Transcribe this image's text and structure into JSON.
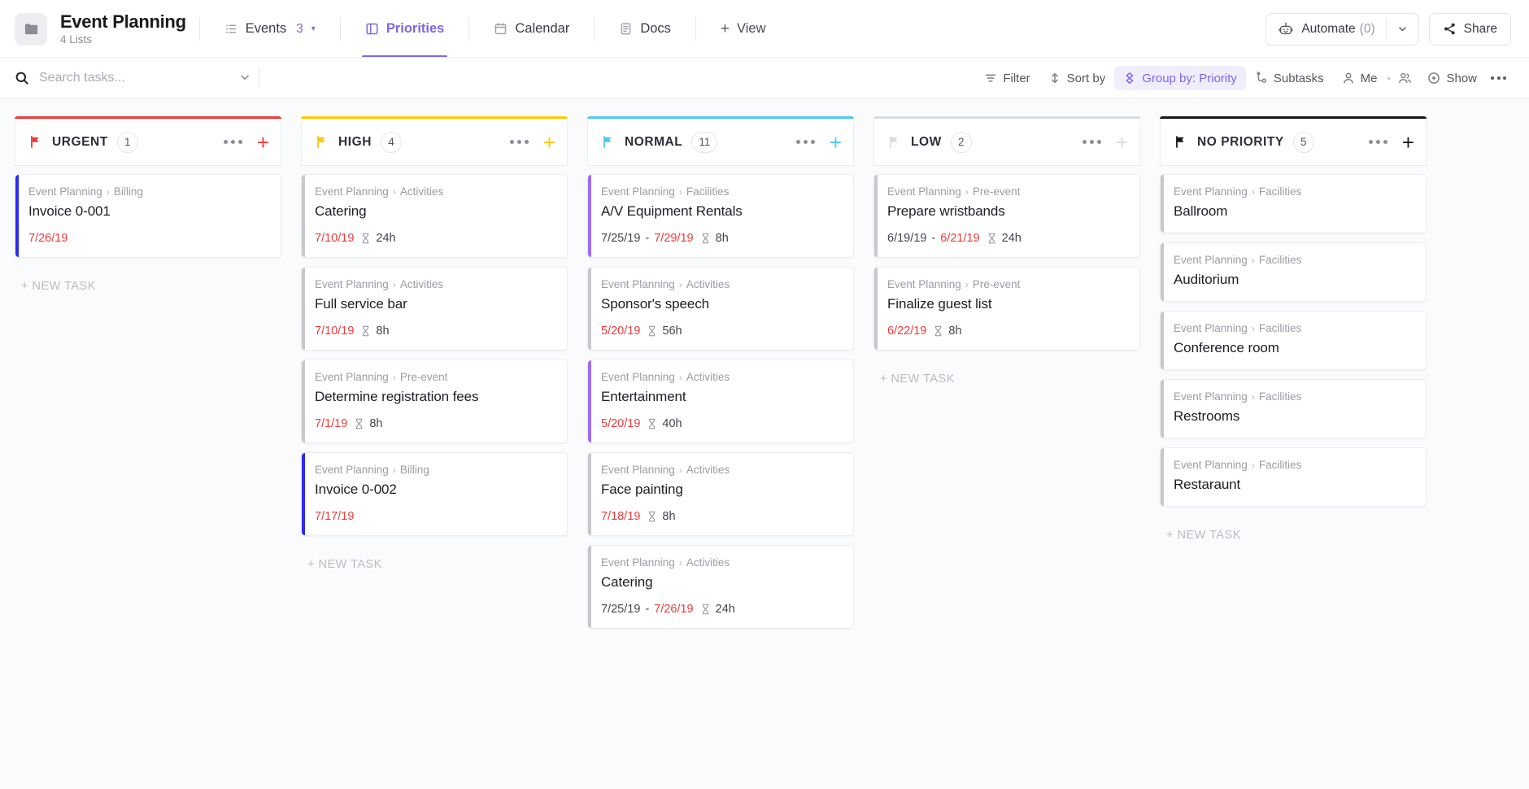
{
  "header": {
    "space_icon": "folder-icon",
    "title": "Event Planning",
    "subtitle": "4 Lists",
    "tabs": [
      {
        "label": "Events",
        "icon": "list-icon",
        "count": "3",
        "caret": "▾",
        "active": false
      },
      {
        "label": "Priorities",
        "icon": "board-icon",
        "active": true
      },
      {
        "label": "Calendar",
        "icon": "calendar-icon",
        "active": false
      },
      {
        "label": "Docs",
        "icon": "doc-icon",
        "active": false
      }
    ],
    "add_view_label": "View",
    "add_view_plus": "+",
    "automate_label": "Automate",
    "automate_count": "(0)",
    "share_label": "Share"
  },
  "toolbar": {
    "search_placeholder": "Search tasks...",
    "search_value": "",
    "items": [
      {
        "label": "Filter",
        "icon": "filter-icon",
        "highlight": false
      },
      {
        "label": "Sort by",
        "icon": "sort-icon",
        "highlight": false
      },
      {
        "label": "Group by: Priority",
        "icon": "group-icon",
        "highlight": true
      },
      {
        "label": "Subtasks",
        "icon": "subtask-icon",
        "highlight": false
      },
      {
        "label": "Me",
        "icon": "person-icon",
        "highlight": false
      },
      {
        "label": "",
        "icon": "people-icon",
        "highlight": false
      },
      {
        "label": "Show",
        "icon": "eye-icon",
        "highlight": false
      }
    ]
  },
  "board": {
    "new_task_label": "+ NEW TASK",
    "columns": [
      {
        "name": "URGENT",
        "count": "1",
        "color": "#f03a3a",
        "flag": "flag-filled-icon",
        "plus_enabled": true,
        "show_new_task": true,
        "cards": [
          {
            "space": "Event Planning",
            "list": "Billing",
            "title": "Invoice 0-001",
            "bar_color": "#2a2af0",
            "date_start": "",
            "date_end": "7/26/19",
            "date_end_overdue": true,
            "estimate": ""
          }
        ]
      },
      {
        "name": "HIGH",
        "count": "4",
        "color": "#ffc800",
        "flag": "flag-filled-icon",
        "plus_enabled": true,
        "show_new_task": true,
        "cards": [
          {
            "space": "Event Planning",
            "list": "Activities",
            "title": "Catering",
            "bar_color": "#c6c8cd",
            "date_start": "",
            "date_end": "7/10/19",
            "date_end_overdue": true,
            "estimate": "24h"
          },
          {
            "space": "Event Planning",
            "list": "Activities",
            "title": "Full service bar",
            "bar_color": "#c6c8cd",
            "date_start": "",
            "date_end": "7/10/19",
            "date_end_overdue": true,
            "estimate": "8h"
          },
          {
            "space": "Event Planning",
            "list": "Pre-event",
            "title": "Determine registration fees",
            "bar_color": "#c6c8cd",
            "date_start": "",
            "date_end": "7/1/19",
            "date_end_overdue": true,
            "estimate": "8h"
          },
          {
            "space": "Event Planning",
            "list": "Billing",
            "title": "Invoice 0-002",
            "bar_color": "#2a2af0",
            "date_start": "",
            "date_end": "7/17/19",
            "date_end_overdue": true,
            "estimate": ""
          }
        ]
      },
      {
        "name": "NORMAL",
        "count": "11",
        "color": "#4ec8f4",
        "flag": "flag-filled-icon",
        "plus_enabled": true,
        "show_new_task": false,
        "cards": [
          {
            "space": "Event Planning",
            "list": "Facilities",
            "title": "A/V Equipment Rentals",
            "bar_color": "#9d6bf5",
            "date_start": "7/25/19",
            "date_end": "7/29/19",
            "date_end_overdue": true,
            "estimate": "8h"
          },
          {
            "space": "Event Planning",
            "list": "Activities",
            "title": "Sponsor's speech",
            "bar_color": "#c6c8cd",
            "date_start": "",
            "date_end": "5/20/19",
            "date_end_overdue": true,
            "estimate": "56h"
          },
          {
            "space": "Event Planning",
            "list": "Activities",
            "title": "Entertainment",
            "bar_color": "#9d6bf5",
            "date_start": "",
            "date_end": "5/20/19",
            "date_end_overdue": true,
            "estimate": "40h"
          },
          {
            "space": "Event Planning",
            "list": "Activities",
            "title": "Face painting",
            "bar_color": "#c6c8cd",
            "date_start": "",
            "date_end": "7/18/19",
            "date_end_overdue": true,
            "estimate": "8h"
          },
          {
            "space": "Event Planning",
            "list": "Activities",
            "title": "Catering",
            "bar_color": "#c6c8cd",
            "date_start": "7/25/19",
            "date_end": "7/26/19",
            "date_end_overdue": true,
            "estimate": "24h"
          }
        ]
      },
      {
        "name": "LOW",
        "count": "2",
        "color": "#d9dbe0",
        "flag": "flag-outline-icon",
        "plus_enabled": false,
        "show_new_task": true,
        "cards": [
          {
            "space": "Event Planning",
            "list": "Pre-event",
            "title": "Prepare wristbands",
            "bar_color": "#c6c8cd",
            "date_start": "6/19/19",
            "date_end": "6/21/19",
            "date_end_overdue": true,
            "estimate": "24h"
          },
          {
            "space": "Event Planning",
            "list": "Pre-event",
            "title": "Finalize guest list",
            "bar_color": "#c6c8cd",
            "date_start": "",
            "date_end": "6/22/19",
            "date_end_overdue": true,
            "estimate": "8h"
          }
        ]
      },
      {
        "name": "NO PRIORITY",
        "count": "5",
        "color": "#16161d",
        "flag": "flag-filled-icon",
        "plus_enabled": true,
        "show_new_task": true,
        "cards": [
          {
            "space": "Event Planning",
            "list": "Facilities",
            "title": "Ballroom",
            "bar_color": "#c6c8cd",
            "date_start": "",
            "date_end": "",
            "date_end_overdue": false,
            "estimate": ""
          },
          {
            "space": "Event Planning",
            "list": "Facilities",
            "title": "Auditorium",
            "bar_color": "#c6c8cd",
            "date_start": "",
            "date_end": "",
            "date_end_overdue": false,
            "estimate": ""
          },
          {
            "space": "Event Planning",
            "list": "Facilities",
            "title": "Conference room",
            "bar_color": "#c6c8cd",
            "date_start": "",
            "date_end": "",
            "date_end_overdue": false,
            "estimate": ""
          },
          {
            "space": "Event Planning",
            "list": "Facilities",
            "title": "Restrooms",
            "bar_color": "#c6c8cd",
            "date_start": "",
            "date_end": "",
            "date_end_overdue": false,
            "estimate": ""
          },
          {
            "space": "Event Planning",
            "list": "Facilities",
            "title": "Restaraunt",
            "bar_color": "#c6c8cd",
            "date_start": "",
            "date_end": "",
            "date_end_overdue": false,
            "estimate": ""
          }
        ]
      }
    ]
  }
}
